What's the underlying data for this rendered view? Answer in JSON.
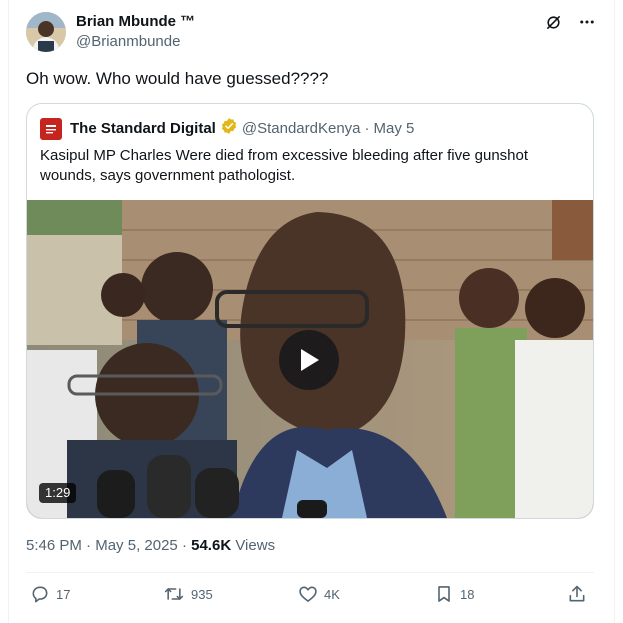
{
  "author": {
    "name": "Brian Mbunde ™",
    "handle": "@Brianmbunde"
  },
  "tweet": {
    "text": "Oh wow. Who would have guessed????"
  },
  "quote": {
    "source_name": "The Standard Digital",
    "source_handle": "@StandardKenya",
    "separator": "·",
    "date": "May 5",
    "text": "Kasipul MP Charles Were died from excessive bleeding after five gunshot wounds, says government pathologist.",
    "video_duration": "1:29"
  },
  "meta": {
    "time": "5:46 PM",
    "separator": "·",
    "date": "May 5, 2025",
    "separator2": "·",
    "views_count": "54.6K",
    "views_label": "Views"
  },
  "actions": {
    "replies": "17",
    "reposts": "935",
    "likes": "4K",
    "bookmarks": "18"
  },
  "icons": {
    "top": [
      "grok-icon",
      "more-icon"
    ],
    "actions": [
      "reply-icon",
      "repost-icon",
      "like-icon",
      "bookmark-icon",
      "share-icon"
    ]
  },
  "colors": {
    "text_primary": "#0f1419",
    "text_secondary": "#536471",
    "border": "#cfd9de",
    "verified_gold": "#e2b719",
    "brand_red": "#c6241f"
  }
}
